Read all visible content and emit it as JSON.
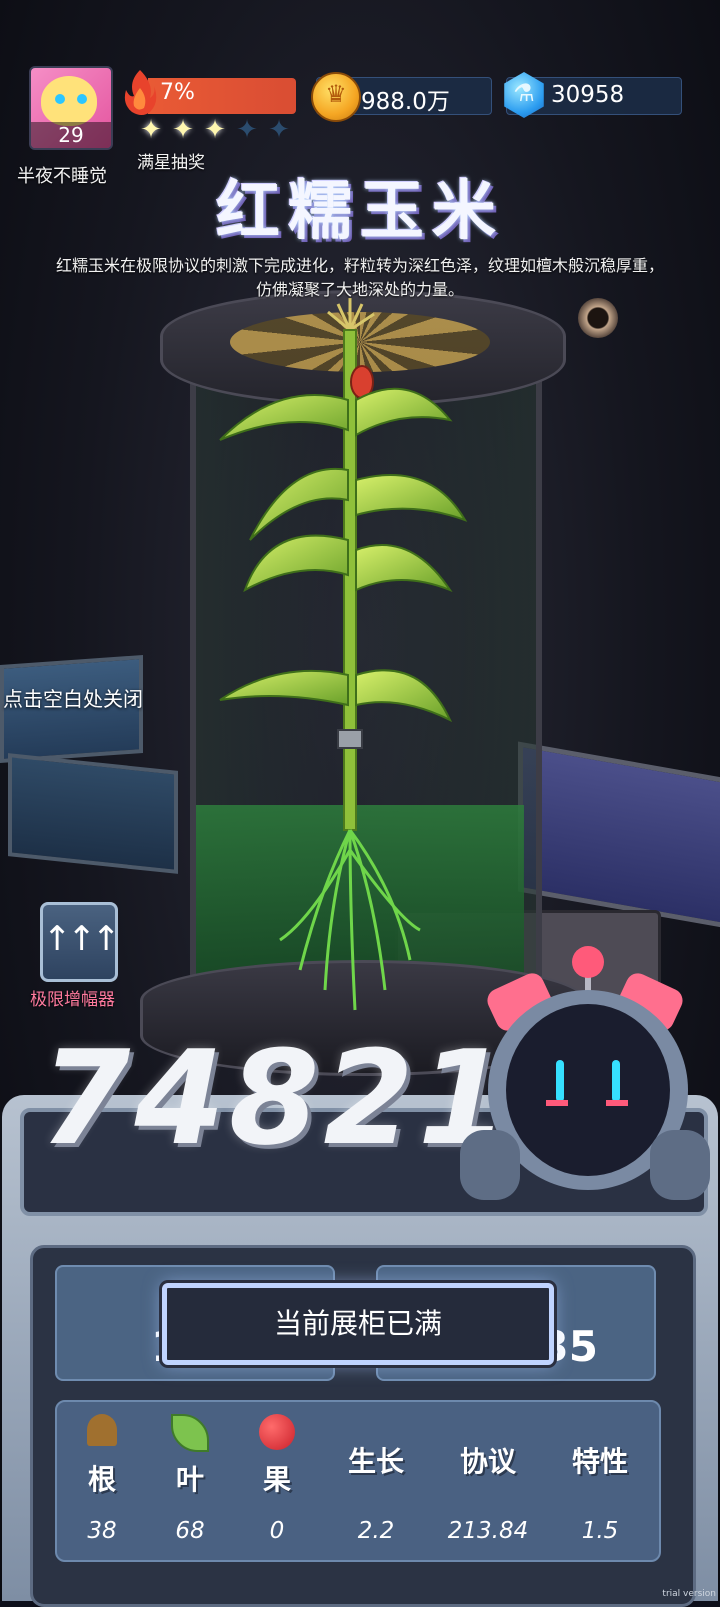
{
  "player": {
    "level": "29",
    "nickname": "半夜不睡觉"
  },
  "star_progress": {
    "percent_text": "7%",
    "percent_value": 7,
    "stars_filled": 3,
    "stars_total": 5,
    "label": "满星抽奖"
  },
  "currency": {
    "gold": "988.0万",
    "gems": "30958"
  },
  "plant": {
    "name": "红糯玉米",
    "description": "红糯玉米在极限协议的刺激下完成进化，籽粒转为深红色泽，纹理如檀木般沉稳厚重，仿佛凝聚了大地深处的力量。"
  },
  "hints": {
    "close": "点击空白处关闭"
  },
  "amplifier": {
    "label": "极限增幅器"
  },
  "score": {
    "value": "74821"
  },
  "toast": {
    "text": "当前展柜已满"
  },
  "stat_boxes": {
    "left_partial_value": "100",
    "right_partial_value": "35"
  },
  "attributes": [
    {
      "label": "根",
      "value": "38",
      "icon": "root-icon"
    },
    {
      "label": "叶",
      "value": "68",
      "icon": "leaf-icon"
    },
    {
      "label": "果",
      "value": "0",
      "icon": "fruit-icon"
    },
    {
      "label": "生长",
      "value": "2.2"
    },
    {
      "label": "协议",
      "value": "213.84"
    },
    {
      "label": "特性",
      "value": "1.5"
    }
  ],
  "watermark": "trial version"
}
